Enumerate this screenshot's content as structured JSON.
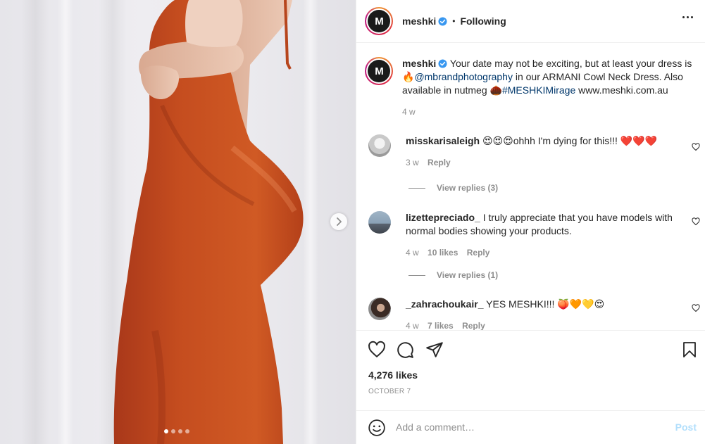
{
  "post": {
    "author": "meshki",
    "follow_state": "Following",
    "separator": "•",
    "avatar_letters": "M",
    "carousel": {
      "slides": 4,
      "active": 1
    }
  },
  "caption": {
    "username": "meshki",
    "text_1": " Your date may not be exciting, but at least your dress is ",
    "fire_emoji": "🔥",
    "mention": "@mbrandphotography",
    "text_2": " in our ARMANI Cowl Neck Dress. Also available in nutmeg ",
    "nutmeg_emoji": "🌰",
    "hashtag": "#MESHKIMirage",
    "text_3": " www.meshki.com.au",
    "age": "4 w"
  },
  "comments": [
    {
      "username": "misskarisaleigh",
      "text": "😍😍😍ohhh I'm dying for this!!! ❤️❤️❤️",
      "age": "3 w",
      "likes": "",
      "reply": "Reply",
      "view_replies": "View replies (3)"
    },
    {
      "username": "lizettepreciado_",
      "text": " I truly appreciate that you have models with normal bodies showing your products.",
      "age": "4 w",
      "likes": "10 likes",
      "reply": "Reply",
      "view_replies": "View replies (1)"
    },
    {
      "username": "_zahrachoukair_",
      "text": " YES MESHKI!!! 🍑🧡💛😍",
      "age": "4 w",
      "likes": "7 likes",
      "reply": "Reply",
      "view_replies": ""
    }
  ],
  "stats": {
    "likes": "4,276 likes",
    "date": "OCTOBER 7"
  },
  "composer": {
    "placeholder": "Add a comment…",
    "post_label": "Post"
  },
  "colors": {
    "dress": "#c8501e",
    "link": "#00376b",
    "verified": "#3897f0",
    "muted": "#8e8e8e",
    "post_disabled": "#b2dffc"
  },
  "icons": [
    "chevron-right-icon",
    "verified-badge-icon",
    "more-icon",
    "heart-icon",
    "comment-icon",
    "share-icon",
    "bookmark-icon",
    "emoji-icon"
  ]
}
